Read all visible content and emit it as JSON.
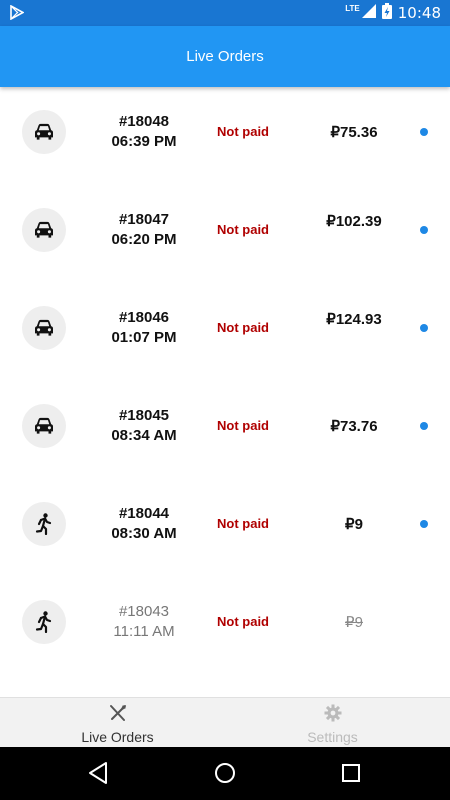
{
  "status_bar": {
    "network": "LTE",
    "time": "10:48"
  },
  "app_bar": {
    "title": "Live Orders"
  },
  "orders": [
    {
      "number": "#18048",
      "time": "06:39 PM",
      "status": "Not paid",
      "price": "₽75.36",
      "icon": "car-icon",
      "active": true
    },
    {
      "number": "#18047",
      "time": "06:20 PM",
      "status": "Not paid",
      "price": "₽102.39",
      "icon": "car-icon",
      "active": true
    },
    {
      "number": "#18046",
      "time": "01:07 PM",
      "status": "Not paid",
      "price": "₽124.93",
      "icon": "car-icon",
      "active": true
    },
    {
      "number": "#18045",
      "time": "08:34 AM",
      "status": "Not paid",
      "price": "₽73.76",
      "icon": "car-icon",
      "active": true
    },
    {
      "number": "#18044",
      "time": "08:30 AM",
      "status": "Not paid",
      "price": "₽9",
      "icon": "walking-person-icon",
      "active": true
    },
    {
      "number": "#18043",
      "time": "11:11 AM",
      "status": "Not paid",
      "price": "₽9",
      "icon": "walking-person-icon",
      "active": false
    }
  ],
  "bottom_nav": {
    "live_orders_label": "Live Orders",
    "settings_label": "Settings"
  },
  "colors": {
    "primary": "#2196F3",
    "status_bar": "#1976D2",
    "not_paid": "#B00000",
    "indicator": "#1E88E5"
  }
}
